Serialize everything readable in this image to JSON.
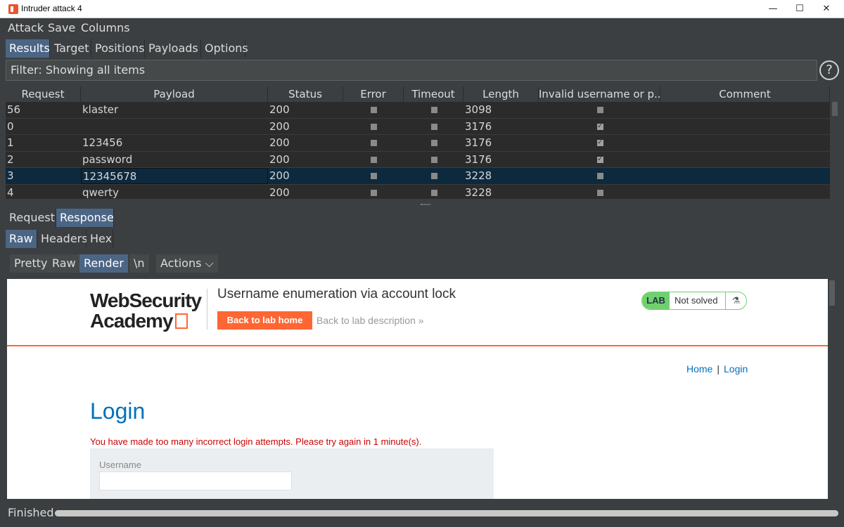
{
  "window": {
    "title": "Intruder attack 4",
    "minimize": "—",
    "maximize": "☐",
    "close": "✕"
  },
  "menu": [
    "Attack",
    "Save",
    "Columns"
  ],
  "main_tabs": [
    "Results",
    "Target",
    "Positions",
    "Payloads",
    "Options"
  ],
  "filter": {
    "text": "Filter: Showing all items",
    "help": "?"
  },
  "table": {
    "columns": [
      "Request",
      "Payload",
      "Status",
      "Error",
      "Timeout",
      "Length",
      "Invalid username or p...",
      "Comment"
    ],
    "rows": [
      {
        "request": "56",
        "payload": "klaster",
        "status": "200",
        "error": false,
        "timeout": false,
        "length": "3098",
        "invalid": false,
        "comment": ""
      },
      {
        "request": "0",
        "payload": "",
        "status": "200",
        "error": false,
        "timeout": false,
        "length": "3176",
        "invalid": true,
        "comment": ""
      },
      {
        "request": "1",
        "payload": "123456",
        "status": "200",
        "error": false,
        "timeout": false,
        "length": "3176",
        "invalid": true,
        "comment": ""
      },
      {
        "request": "2",
        "payload": "password",
        "status": "200",
        "error": false,
        "timeout": false,
        "length": "3176",
        "invalid": true,
        "comment": ""
      },
      {
        "request": "3",
        "payload": "12345678",
        "status": "200",
        "error": false,
        "timeout": false,
        "length": "3228",
        "invalid": false,
        "comment": ""
      },
      {
        "request": "4",
        "payload": "qwerty",
        "status": "200",
        "error": false,
        "timeout": false,
        "length": "3228",
        "invalid": false,
        "comment": ""
      }
    ],
    "selected_index": 4
  },
  "message_tabs": [
    "Request",
    "Response"
  ],
  "view_tabs": [
    "Raw",
    "Headers",
    "Hex"
  ],
  "render_toolbar": {
    "pretty": "Pretty",
    "raw": "Raw",
    "render": "Render",
    "newline": "\\n",
    "actions": "Actions ⌵"
  },
  "rendered_page": {
    "logo_line1": "WebSecurity",
    "logo_line2": "Academy",
    "lab_title": "Username enumeration via account lock",
    "back_home": "Back to lab home",
    "back_description": "Back to lab description »",
    "badge_lab": "LAB",
    "badge_status": "Not solved",
    "flask_icon": "⚗",
    "nav_home": "Home",
    "nav_separator": "|",
    "nav_login": "Login",
    "heading": "Login",
    "error": "You have made too many incorrect login attempts. Please try again in 1 minute(s).",
    "username_label": "Username"
  },
  "statusbar": {
    "text": "Finished",
    "progress": 1.0
  },
  "colors": {
    "accent_orange": "#ff6633",
    "tab_active": "#4b6584",
    "link_blue": "#0071bc",
    "error_red": "#cc0000",
    "lab_green": "#70d070"
  }
}
